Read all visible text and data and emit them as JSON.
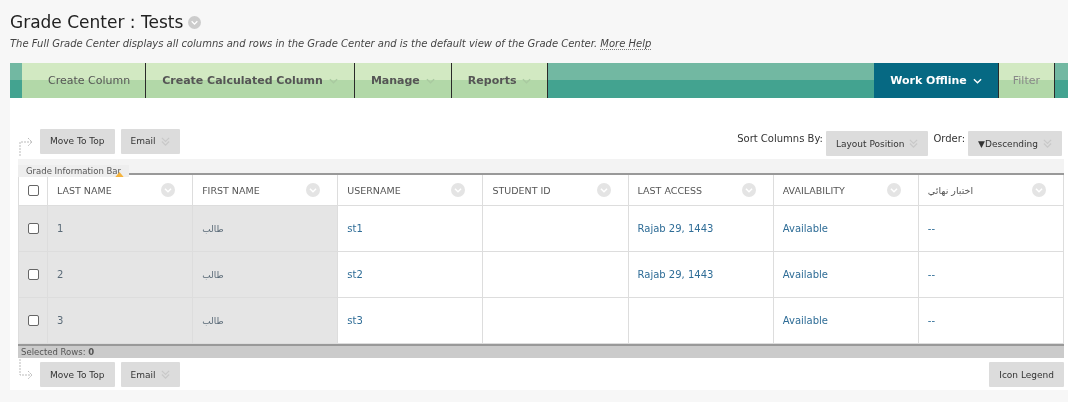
{
  "page": {
    "title": "Grade Center : Tests",
    "description": "The Full Grade Center displays all columns and rows in the Grade Center and is the default view of the Grade Center.",
    "help_link": "More Help"
  },
  "toolbar": {
    "left": [
      {
        "label": "Create Column",
        "dropdown": false
      },
      {
        "label": "Create Calculated Column",
        "dropdown": true
      },
      {
        "label": "Manage",
        "dropdown": true
      },
      {
        "label": "Reports",
        "dropdown": true
      }
    ],
    "right": [
      {
        "label": "Work Offline",
        "kind": "primary",
        "dropdown": true
      },
      {
        "label": "Filter",
        "kind": "plain",
        "dropdown": false
      }
    ]
  },
  "actions_top": [
    {
      "label": "Move To Top",
      "dropdown": false
    },
    {
      "label": "Email",
      "dropdown": true
    }
  ],
  "sort": {
    "label": "Sort Columns By:",
    "value": "Layout Position",
    "order_label": "Order:",
    "order_value": "Descending",
    "order_arrow": "▼"
  },
  "info_bar": "Grade Information Bar",
  "table": {
    "select_all_checked": false,
    "columns": [
      {
        "label": "LAST NAME",
        "sorted": true
      },
      {
        "label": "FIRST NAME",
        "sorted": false
      },
      {
        "label": "USERNAME",
        "sorted": false
      },
      {
        "label": "STUDENT ID",
        "sorted": false
      },
      {
        "label": "LAST ACCESS",
        "sorted": false
      },
      {
        "label": "AVAILABILITY",
        "sorted": false
      },
      {
        "label": "اختبار نهائي",
        "sorted": false
      }
    ],
    "rows": [
      {
        "checked": false,
        "cells": [
          "1",
          "طالب",
          "st1",
          "",
          "Rajab 29, 1443",
          "Available",
          "--"
        ]
      },
      {
        "checked": false,
        "cells": [
          "2",
          "طالب",
          "st2",
          "",
          "Rajab 29, 1443",
          "Available",
          "--"
        ]
      },
      {
        "checked": false,
        "cells": [
          "3",
          "طالب",
          "st3",
          "",
          "",
          "Available",
          "--"
        ]
      }
    ]
  },
  "selected_rows": {
    "label": "Selected Rows:",
    "count": "0"
  },
  "actions_bottom": [
    {
      "label": "Move To Top",
      "dropdown": false
    },
    {
      "label": "Email",
      "dropdown": true
    }
  ],
  "icon_legend": "Icon Legend"
}
